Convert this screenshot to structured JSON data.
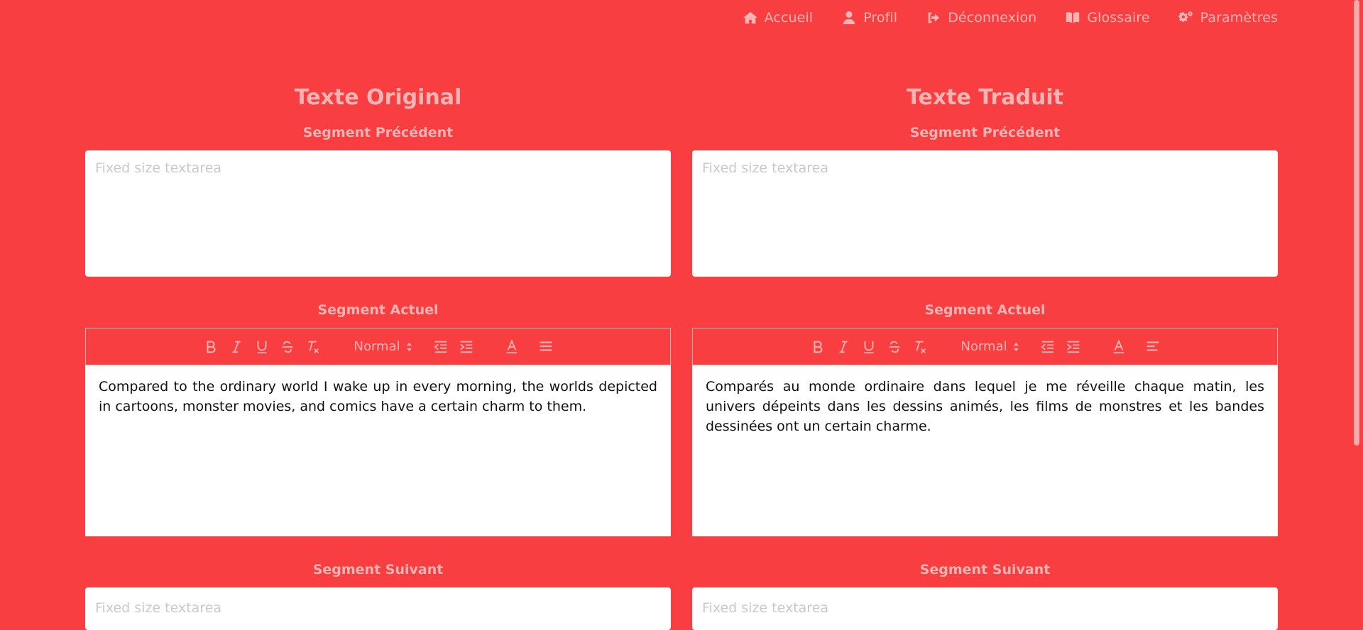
{
  "nav": {
    "items": [
      {
        "label": "Accueil",
        "icon": "home-icon"
      },
      {
        "label": "Profil",
        "icon": "user-icon"
      },
      {
        "label": "Déconnexion",
        "icon": "logout-icon"
      },
      {
        "label": "Glossaire",
        "icon": "book-icon"
      },
      {
        "label": "Paramètres",
        "icon": "cogs-icon"
      }
    ]
  },
  "left": {
    "title": "Texte Original",
    "prev_label": "Segment Précédent",
    "prev_placeholder": "Fixed size textarea",
    "cur_label": "Segment Actuel",
    "format_value": "Normal",
    "current_text": "Compared to the ordinary world I wake up in every morning, the worlds depicted in cartoons, monster movies, and comics have a certain charm to them.",
    "next_label": "Segment Suivant",
    "next_placeholder": "Fixed size textarea"
  },
  "right": {
    "title": "Texte Traduit",
    "prev_label": "Segment Précédent",
    "prev_placeholder": "Fixed size textarea",
    "cur_label": "Segment Actuel",
    "format_value": "Normal",
    "current_text": "Comparés au monde ordinaire dans lequel je me réveille chaque matin, les univers dépeints dans les dessins animés, les films de monstres et les bandes dessinées ont un certain charme.",
    "next_label": "Segment Suivant",
    "next_placeholder": "Fixed size textarea"
  },
  "colors": {
    "background": "#f93e41",
    "muted_text": "#f7b4b3",
    "panel": "#ffffff"
  }
}
